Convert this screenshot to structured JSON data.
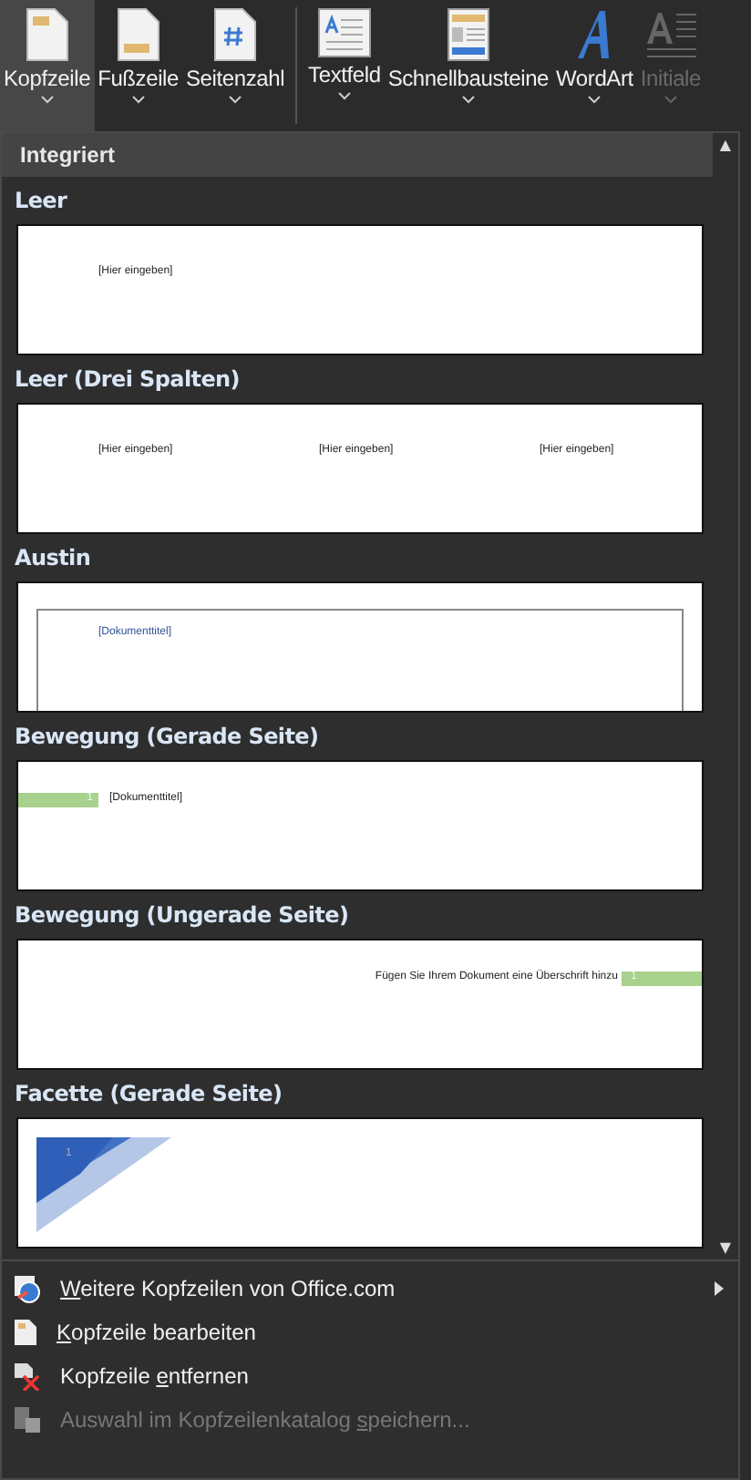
{
  "ribbon": {
    "buttons": [
      {
        "label": "Kopfzeile",
        "kind": "header",
        "selected": true,
        "disabled": false
      },
      {
        "label": "Fußzeile",
        "kind": "footer",
        "selected": false,
        "disabled": false
      },
      {
        "label": "Seitenzahl",
        "kind": "pagenumber",
        "selected": false,
        "disabled": false
      },
      {
        "label": "Textfeld",
        "kind": "textbox",
        "selected": false,
        "disabled": false,
        "separator_before": true
      },
      {
        "label": "Schnellbausteine",
        "kind": "quickparts",
        "selected": false,
        "disabled": false
      },
      {
        "label": "WordArt",
        "kind": "wordart",
        "selected": false,
        "disabled": false
      },
      {
        "label": "Initiale",
        "kind": "dropcap",
        "selected": false,
        "disabled": true
      }
    ]
  },
  "gallery": {
    "section": "Integriert",
    "scroll_up": "▲",
    "scroll_down": "▼",
    "items": [
      {
        "title": "Leer",
        "kind": "single",
        "texts": [
          "[Hier eingeben]"
        ]
      },
      {
        "title": "Leer (Drei Spalten)",
        "kind": "three",
        "texts": [
          "[Hier eingeben]",
          "[Hier eingeben]",
          "[Hier eingeben]"
        ]
      },
      {
        "title": "Austin",
        "kind": "austin",
        "texts": [
          "[Dokumenttitel]"
        ]
      },
      {
        "title": "Bewegung (Gerade Seite)",
        "kind": "motion_even",
        "texts": [
          "[Dokumenttitel]"
        ],
        "page_number": "1"
      },
      {
        "title": "Bewegung (Ungerade Seite)",
        "kind": "motion_odd",
        "texts": [
          "Fügen Sie Ihrem Dokument eine Überschrift hinzu"
        ],
        "page_number": "1"
      },
      {
        "title": "Facette (Gerade Seite)",
        "kind": "facet",
        "page_number": "1"
      }
    ]
  },
  "menu": [
    {
      "key": "W",
      "post": "eitere Kopfzeilen von Office.com",
      "kind": "globe",
      "submenu": true,
      "disabled": false
    },
    {
      "key": "K",
      "post": "opfzeile bearbeiten",
      "kind": "edit",
      "submenu": false,
      "disabled": false
    },
    {
      "pre": "Kopfzeile ",
      "key": "e",
      "post": "ntfernen",
      "kind": "remove",
      "submenu": false,
      "disabled": false
    },
    {
      "pre": "Auswahl im Kopfzeilenkatalog ",
      "key": "s",
      "post": "peichern...",
      "kind": "save",
      "submenu": false,
      "disabled": true
    }
  ]
}
